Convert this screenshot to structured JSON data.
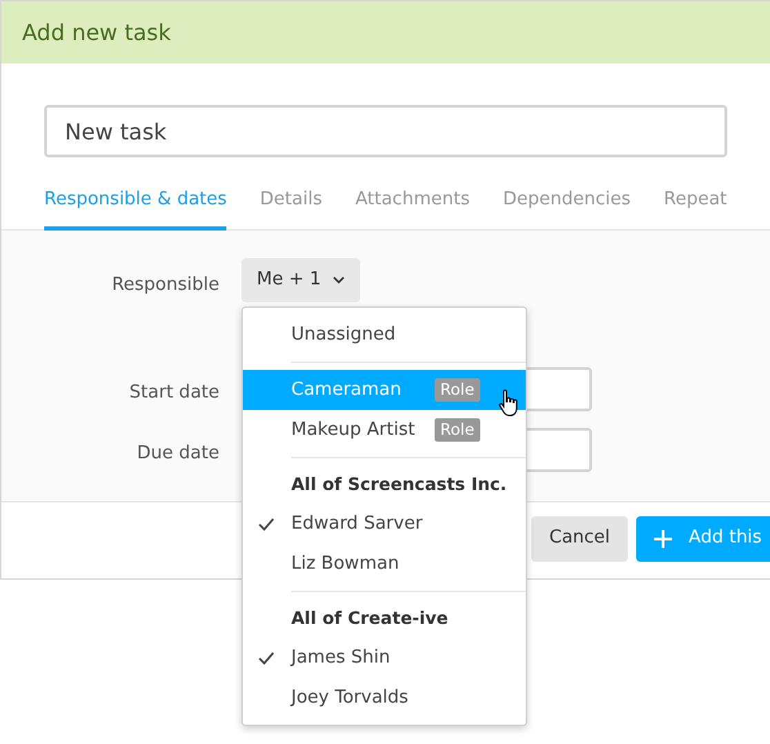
{
  "dialog": {
    "title": "Add new task"
  },
  "task_name": {
    "value": "New task"
  },
  "tabs": [
    {
      "label": "Responsible & dates",
      "selected": true
    },
    {
      "label": "Details",
      "selected": false
    },
    {
      "label": "Attachments",
      "selected": false
    },
    {
      "label": "Dependencies",
      "selected": false
    },
    {
      "label": "Repeat",
      "selected": false
    }
  ],
  "form": {
    "responsible_label": "Responsible",
    "responsible_value": "Me + 1",
    "start_date_label": "Start date",
    "due_date_label": "Due date"
  },
  "menu": {
    "groups": [
      {
        "items": [
          {
            "label": "Unassigned",
            "selected": false,
            "checked": false
          }
        ]
      },
      {
        "items": [
          {
            "label": "Cameraman",
            "badge": "Role",
            "selected": true,
            "checked": false
          },
          {
            "label": "Makeup Artist",
            "badge": "Role",
            "selected": false,
            "checked": false
          }
        ]
      },
      {
        "heading": "All of Screencasts Inc.",
        "items": [
          {
            "label": "Edward Sarver",
            "selected": false,
            "checked": true
          },
          {
            "label": "Liz Bowman",
            "selected": false,
            "checked": false
          }
        ]
      },
      {
        "heading": "All of Create-ive",
        "items": [
          {
            "label": "James Shin",
            "selected": false,
            "checked": true
          },
          {
            "label": "Joey Torvalds",
            "selected": false,
            "checked": false
          }
        ]
      }
    ]
  },
  "buttons": {
    "cancel": "Cancel",
    "add": "Add this"
  }
}
